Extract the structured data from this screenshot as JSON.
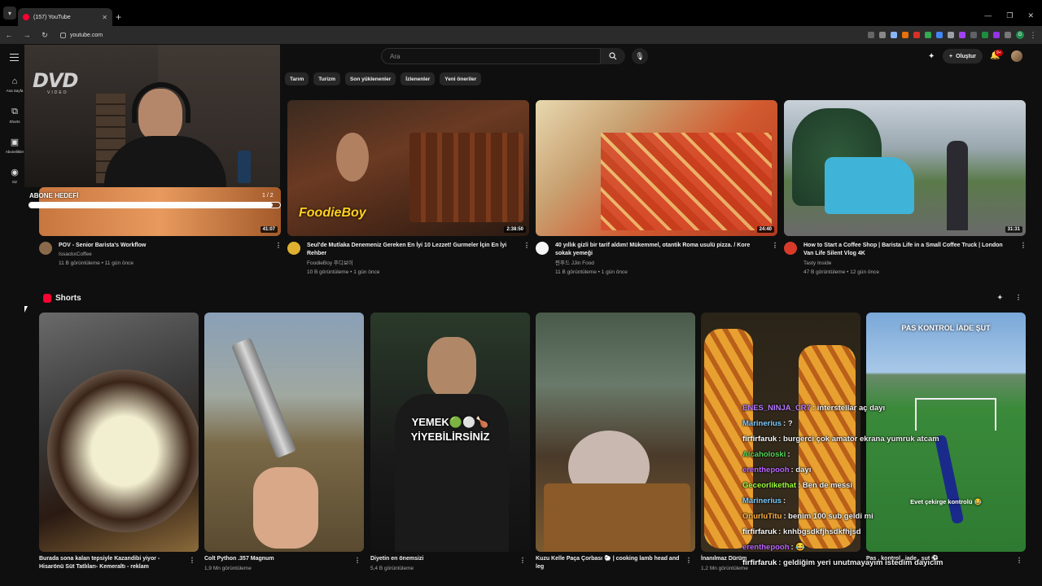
{
  "browser": {
    "tab_title": "(157) YouTube",
    "url": "youtube.com",
    "new_tab": "+",
    "close": "✕"
  },
  "header": {
    "search_placeholder": "Ara",
    "create_label": "Oluştur",
    "notif_badge": "9+"
  },
  "sidebar": {
    "items": [
      {
        "label": "Ana Sayfa",
        "icon": "home-icon"
      },
      {
        "label": "Shorts",
        "icon": "shorts-icon"
      },
      {
        "label": "Abonelikler",
        "icon": "subscriptions-icon"
      },
      {
        "label": "Siz",
        "icon": "you-icon"
      }
    ]
  },
  "chips": [
    "Tarım",
    "Turizm",
    "Son yüklenenler",
    "İzlenenler",
    "Yeni öneriler"
  ],
  "overlay": {
    "dvd": "DVD",
    "dvd_sub": "VIDEO",
    "subscribe_label": "ABONE HEDEFİ",
    "subscribe_count": "1 / 2",
    "subscribe_progress": 0.97
  },
  "videos": [
    {
      "title": "POV - Senior Barista's Workflow",
      "channel": "IssackxCoffee",
      "meta": "11 B görüntüleme • 11 gün önce",
      "duration": "41:07"
    },
    {
      "title": "Seul'de Mutlaka Denemeniz Gereken En İyi 10 Lezzet! Gurmeler İçin En İyi Rehber",
      "channel": "FoodieBoy 푸디보이",
      "meta": "10 B görüntüleme • 1 gün önce",
      "duration": "2:38:50",
      "thumb_text": "FoodieBoy"
    },
    {
      "title": "40 yıllık gizli bir tarif aldım! Mükemmel, otantik Roma usulü pizza. / Kore sokak yemeği",
      "channel": "찐푸드 JJin Food",
      "meta": "11 B görüntüleme • 1 gün önce",
      "duration": "24:40"
    },
    {
      "title": "How to Start a Coffee Shop | Barista Life in a Small Coffee Truck | London Van Life Silent Vlog 4K",
      "channel": "Tasty Inside",
      "meta": "47 B görüntüleme • 12 gün önce",
      "duration": "31:31"
    }
  ],
  "shorts": {
    "title": "Shorts",
    "items": [
      {
        "title": "Burada sona kalan tepsiyle Kazandibi yiyor - Hisarönü Süt Tatlıları- Kemeraltı - reklam",
        "meta": ""
      },
      {
        "title": "Colt Python .357 Magnum",
        "meta": "1,9 Mn görüntüleme"
      },
      {
        "title": "Diyetin en önemsizi",
        "meta": "5,4 B görüntüleme",
        "overlay": "YEMEK🟢⚪🍗 YİYEBİLİRSİNİZ"
      },
      {
        "title": "Kuzu Kelle Paça Çorbası 🐑 | cooking lamb head and leg",
        "meta": ""
      },
      {
        "title": "İnanılmaz Dürüm",
        "meta": "1,2 Mn görüntüleme"
      },
      {
        "title": "Pas , kontrol , iade , şut ⚽",
        "meta": "",
        "overlay_top": "PAS KONTROL İADE ŞUT",
        "overlay_mid": "Evet çekirge kontrolü 😂"
      }
    ]
  },
  "chat": [
    {
      "user": "ENES_NINJA_CR7",
      "text": ": interstellar aç dayı",
      "color": "#b57aff"
    },
    {
      "user": "Marinerius",
      "text": ": ?",
      "color": "#7ecbff"
    },
    {
      "user": "firfirfaruk",
      "text": ": burgerci çok amatör ekrana yumruk atcam",
      "color": "#ffffff"
    },
    {
      "user": "Alcaholoski",
      "text": ":",
      "color": "#56d45a"
    },
    {
      "user": "erenthepooh",
      "text": ": dayı",
      "color": "#bb66ff"
    },
    {
      "user": "Geceorlikethat",
      "text": ": Ben de messi",
      "color": "#9fff3f"
    },
    {
      "user": "Marinerius",
      "text": ":",
      "color": "#7ecbff"
    },
    {
      "user": "OnurluTitu",
      "text": ": benim 100 sub geldi mi",
      "color": "#ffb347"
    },
    {
      "user": "firfirfaruk",
      "text": ": knhbgsdkfjhsdkfhjsd",
      "color": "#ffffff"
    },
    {
      "user": "erenthepooh",
      "text": ": 😂",
      "color": "#bb66ff"
    },
    {
      "user": "firfirfaruk",
      "text": ": geldiğim yeri unutmayayım istedim dayıcım",
      "color": "#ffffff"
    }
  ]
}
